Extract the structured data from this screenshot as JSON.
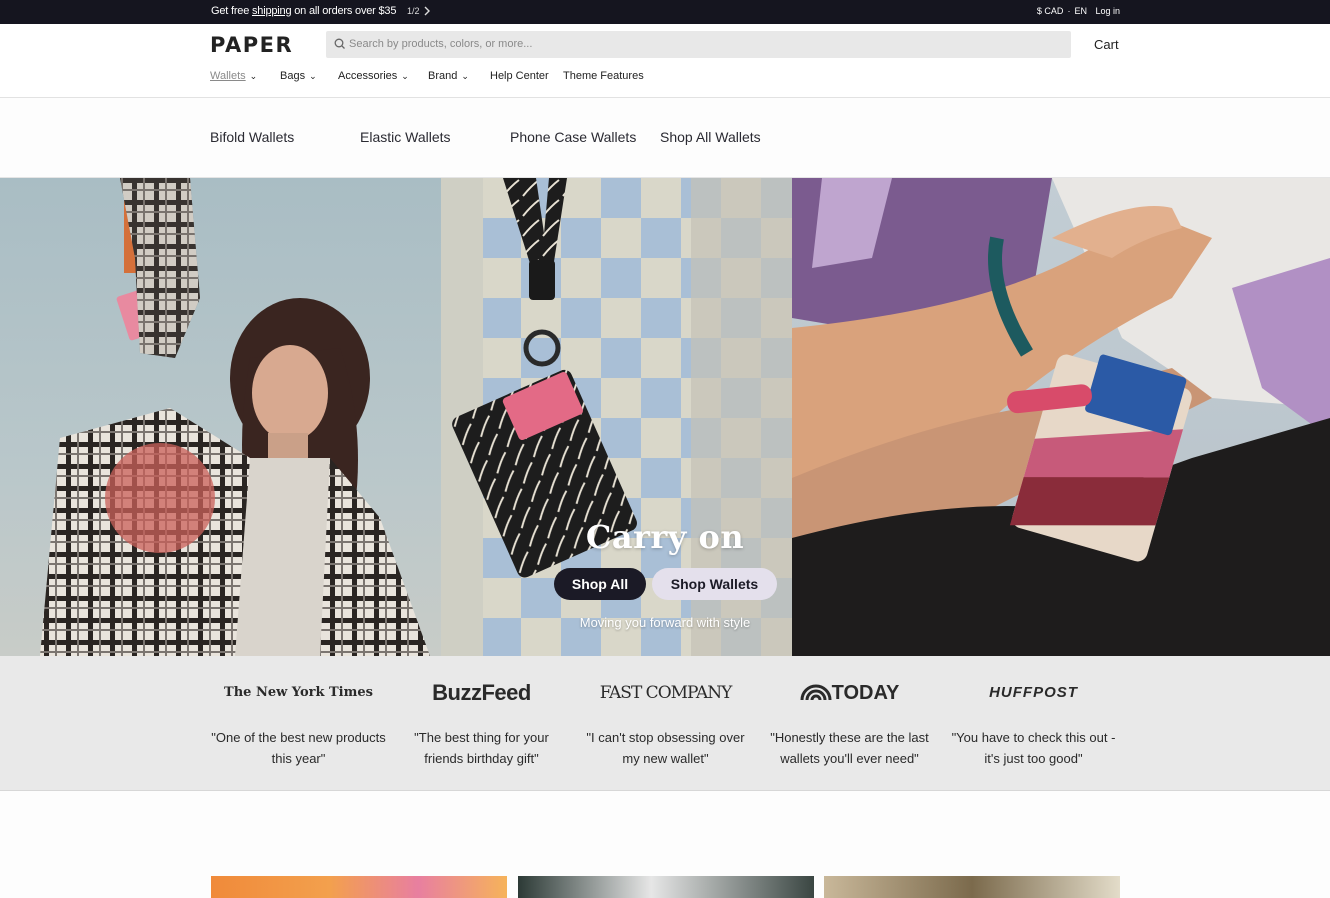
{
  "announcement": {
    "text_before": "Get free ",
    "link": "shipping",
    "text_after": " on all orders over $35",
    "pager": "1/2",
    "currency": "$ CAD",
    "separator": "·",
    "language": "EN",
    "login": "Log in"
  },
  "header": {
    "logo": "PAPER",
    "search_placeholder": "Search by products, colors, or more...",
    "cart": "Cart"
  },
  "nav": [
    {
      "label": "Wallets",
      "dropdown": true
    },
    {
      "label": "Bags",
      "dropdown": true
    },
    {
      "label": "Accessories",
      "dropdown": true
    },
    {
      "label": "Brand",
      "dropdown": true
    },
    {
      "label": "Help Center",
      "dropdown": false
    },
    {
      "label": "Theme Features",
      "dropdown": false
    }
  ],
  "subnav": [
    "Bifold Wallets",
    "Elastic Wallets",
    "Phone Case Wallets",
    "Shop All Wallets"
  ],
  "hero": {
    "title": "Carry on",
    "primary_button": "Shop All",
    "secondary_button": "Shop Wallets",
    "subtitle": "Moving you forward with style"
  },
  "press": [
    {
      "logo": "The New York Times",
      "quote": "\"One of the best new products this year\""
    },
    {
      "logo": "BuzzFeed",
      "quote": "\"The best thing for your friends birthday gift\""
    },
    {
      "logo": "FAST COMPANY",
      "quote": "\"I can't stop obsessing over my new wallet\""
    },
    {
      "logo": "TODAY",
      "quote": "\"Honestly these are the last wallets you'll ever need\""
    },
    {
      "logo": "HUFFPOST",
      "quote": "\"You have to check this out - it's just too good\""
    }
  ],
  "colors": {
    "announcement_bg": "#15151f",
    "primary_button": "#1b1a26",
    "secondary_button": "#e4e0ec",
    "press_bg": "#e9e9e9"
  }
}
